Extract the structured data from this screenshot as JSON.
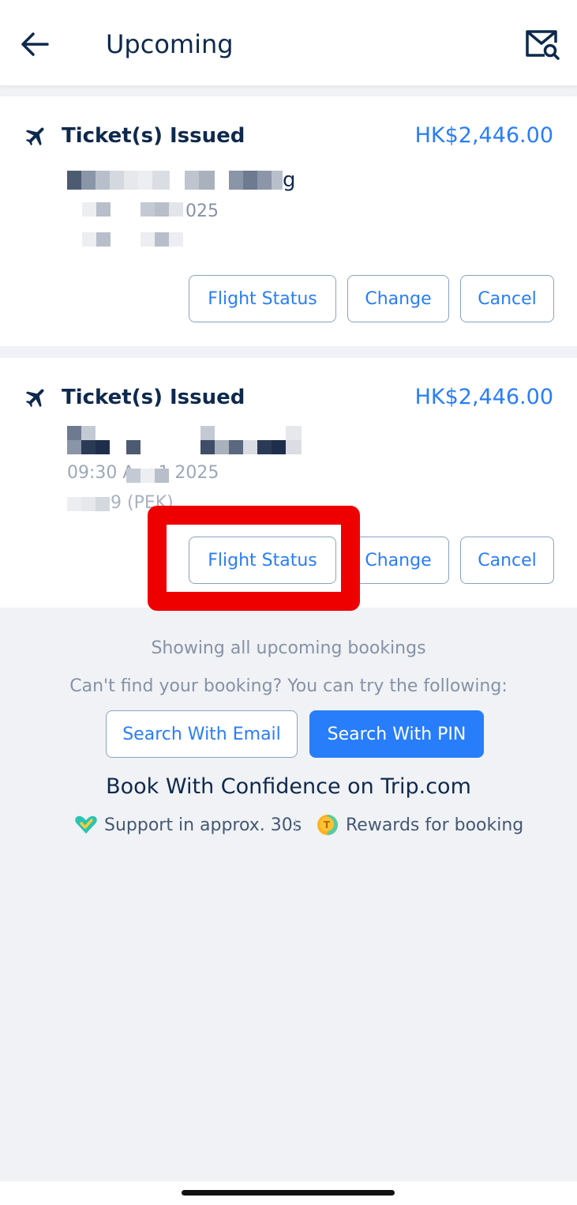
{
  "header": {
    "title": "Upcoming",
    "back_icon": "arrow-left-icon",
    "mail_search_icon": "mail-search-icon"
  },
  "bookings": [
    {
      "status": "Ticket(s) Issued",
      "price": "HK$2,446.00",
      "route_visible": "g",
      "date_visible": "025",
      "buttons": {
        "flight_status": "Flight Status",
        "change": "Change",
        "cancel": "Cancel"
      }
    },
    {
      "status": "Ticket(s) Issued",
      "price": "HK$2,446.00",
      "date_visible": "09:30 Apr 1 2025",
      "airport_visible": "9 (PEK)",
      "buttons": {
        "flight_status": "Flight Status",
        "change": "Change",
        "cancel": "Cancel"
      }
    }
  ],
  "footer": {
    "showing_text": "Showing all upcoming bookings",
    "help_text": "Can't find your booking? You can try the following:",
    "search_email": "Search With Email",
    "search_pin": "Search With PIN",
    "confidence_title": "Book With Confidence on Trip.com",
    "feature_support": "Support in approx. 30s",
    "feature_rewards": "Rewards for booking"
  },
  "colors": {
    "accent": "#287dfa",
    "text_dark": "#0f294d",
    "text_muted": "#8592a6",
    "highlight": "#ee0000",
    "background": "#f0f2f5"
  }
}
